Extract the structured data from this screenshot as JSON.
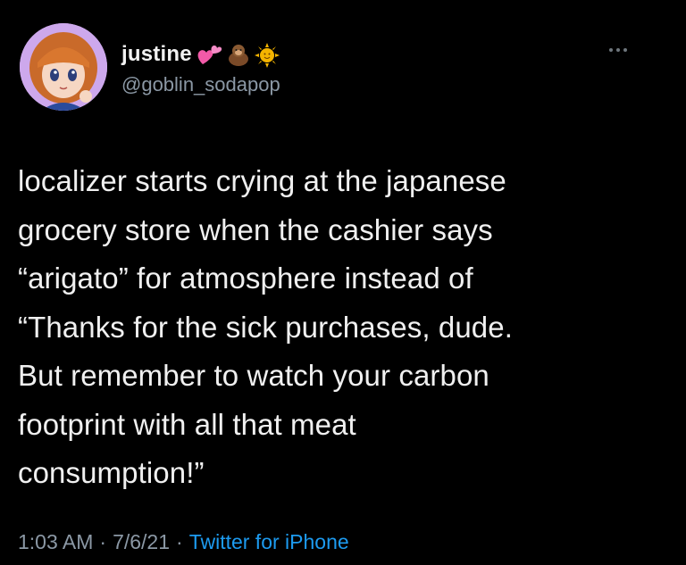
{
  "user": {
    "display_name": "justine",
    "handle": "@goblin_sodapop",
    "name_emojis": [
      "heart-icon",
      "monkey-icon",
      "sun-icon"
    ]
  },
  "tweet": {
    "text": "localizer starts crying at the japanese\ngrocery store when the cashier says\n“arigato” for atmosphere instead of\n“Thanks for the sick purchases, dude.\nBut remember to watch your carbon\nfootprint with all that meat\nconsumption!”",
    "time": "1:03 AM",
    "separator": "·",
    "date": "7/6/21",
    "source": "Twitter for iPhone"
  },
  "colors": {
    "background": "#000000",
    "text": "#f0f0f0",
    "muted": "#8b98a5",
    "link": "#1d9bf0"
  }
}
